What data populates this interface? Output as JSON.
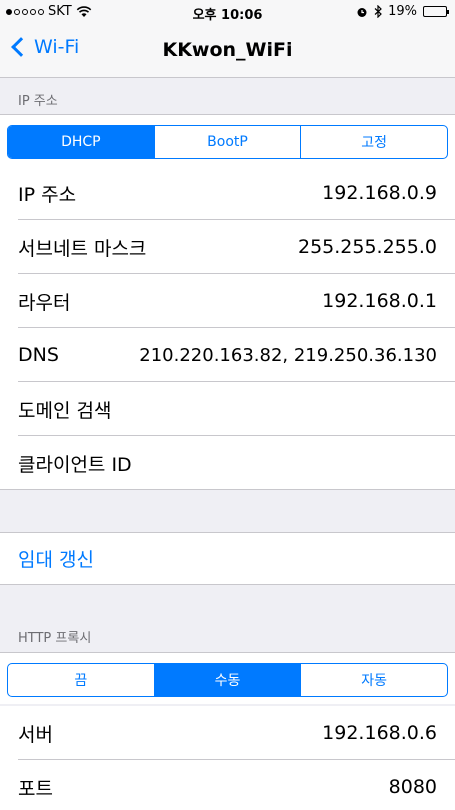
{
  "status_bar": {
    "carrier": "SKT",
    "time": "오후 10:06",
    "battery_percent": "19%",
    "battery_level": 0.19
  },
  "nav": {
    "back_label": "Wi-Fi",
    "title": "KKwon_WiFi"
  },
  "ip_section": {
    "header": "IP 주소",
    "modes": [
      "DHCP",
      "BootP",
      "고정"
    ],
    "selected_mode": "DHCP",
    "rows": [
      {
        "label": "IP 주소",
        "value": "192.168.0.9"
      },
      {
        "label": "서브네트 마스크",
        "value": "255.255.255.0"
      },
      {
        "label": "라우터",
        "value": "192.168.0.1"
      },
      {
        "label": "DNS",
        "value": "210.220.163.82, 219.250.36.130"
      },
      {
        "label": "도메인 검색",
        "value": ""
      },
      {
        "label": "클라이언트 ID",
        "value": ""
      }
    ]
  },
  "renew_lease": "임대 갱신",
  "proxy_section": {
    "header": "HTTP 프록시",
    "modes": [
      "끔",
      "수동",
      "자동"
    ],
    "selected_mode": "수동",
    "rows": [
      {
        "label": "서버",
        "value": "192.168.0.6"
      },
      {
        "label": "포트",
        "value": "8080"
      }
    ]
  },
  "colors": {
    "accent": "#007aff",
    "background": "#efeff4",
    "battery_low": "#ff3b30"
  }
}
